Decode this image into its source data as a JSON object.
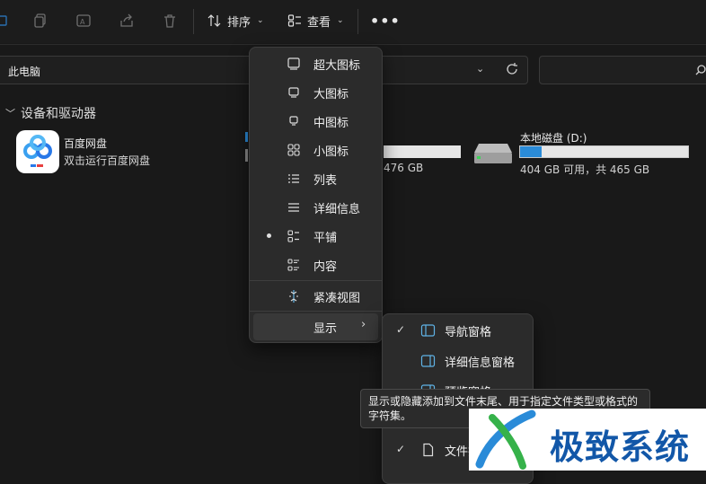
{
  "toolbar": {
    "sort_label": "排序",
    "view_label": "查看",
    "more_label": "•••"
  },
  "address": {
    "path": "此电脑"
  },
  "group": {
    "title": "设备和驱动器"
  },
  "baidu": {
    "name": "百度网盘",
    "subtitle": "双击运行百度网盘"
  },
  "drive_c_fragment": {
    "size_text": "476 GB"
  },
  "drive_d": {
    "title": "本地磁盘 (D:)",
    "free_text": "404 GB 可用，共 465 GB",
    "used_fraction": 0.131
  },
  "view_menu": {
    "items": [
      {
        "label": "超大图标",
        "icon": "monitor-large-icon"
      },
      {
        "label": "大图标",
        "icon": "monitor-icon"
      },
      {
        "label": "中图标",
        "icon": "monitor-small-icon"
      },
      {
        "label": "小图标",
        "icon": "small-icons-grid-icon"
      },
      {
        "label": "列表",
        "icon": "list-icon"
      },
      {
        "label": "详细信息",
        "icon": "details-icon"
      },
      {
        "label": "平铺",
        "icon": "tiles-icon",
        "selected": true
      },
      {
        "label": "内容",
        "icon": "content-icon"
      },
      {
        "label": "紧凑视图",
        "icon": "compact-view-icon"
      },
      {
        "label": "显示",
        "icon": "",
        "has_submenu": true
      }
    ]
  },
  "show_submenu": {
    "items": [
      {
        "label": "导航窗格",
        "checked": true
      },
      {
        "label": "详细信息窗格",
        "checked": false
      },
      {
        "label": "预览窗格",
        "checked": false
      },
      {
        "label": "文件扩展名",
        "checked": true
      }
    ]
  },
  "tooltip": {
    "text": "显示或隐藏添加到文件末尾、用于指定文件类型或格式的字符集。"
  },
  "watermark": {
    "text": "极致系统"
  },
  "colors": {
    "accent": "#2a8bd8",
    "background": "#191919",
    "menu": "#2b2b2b"
  }
}
